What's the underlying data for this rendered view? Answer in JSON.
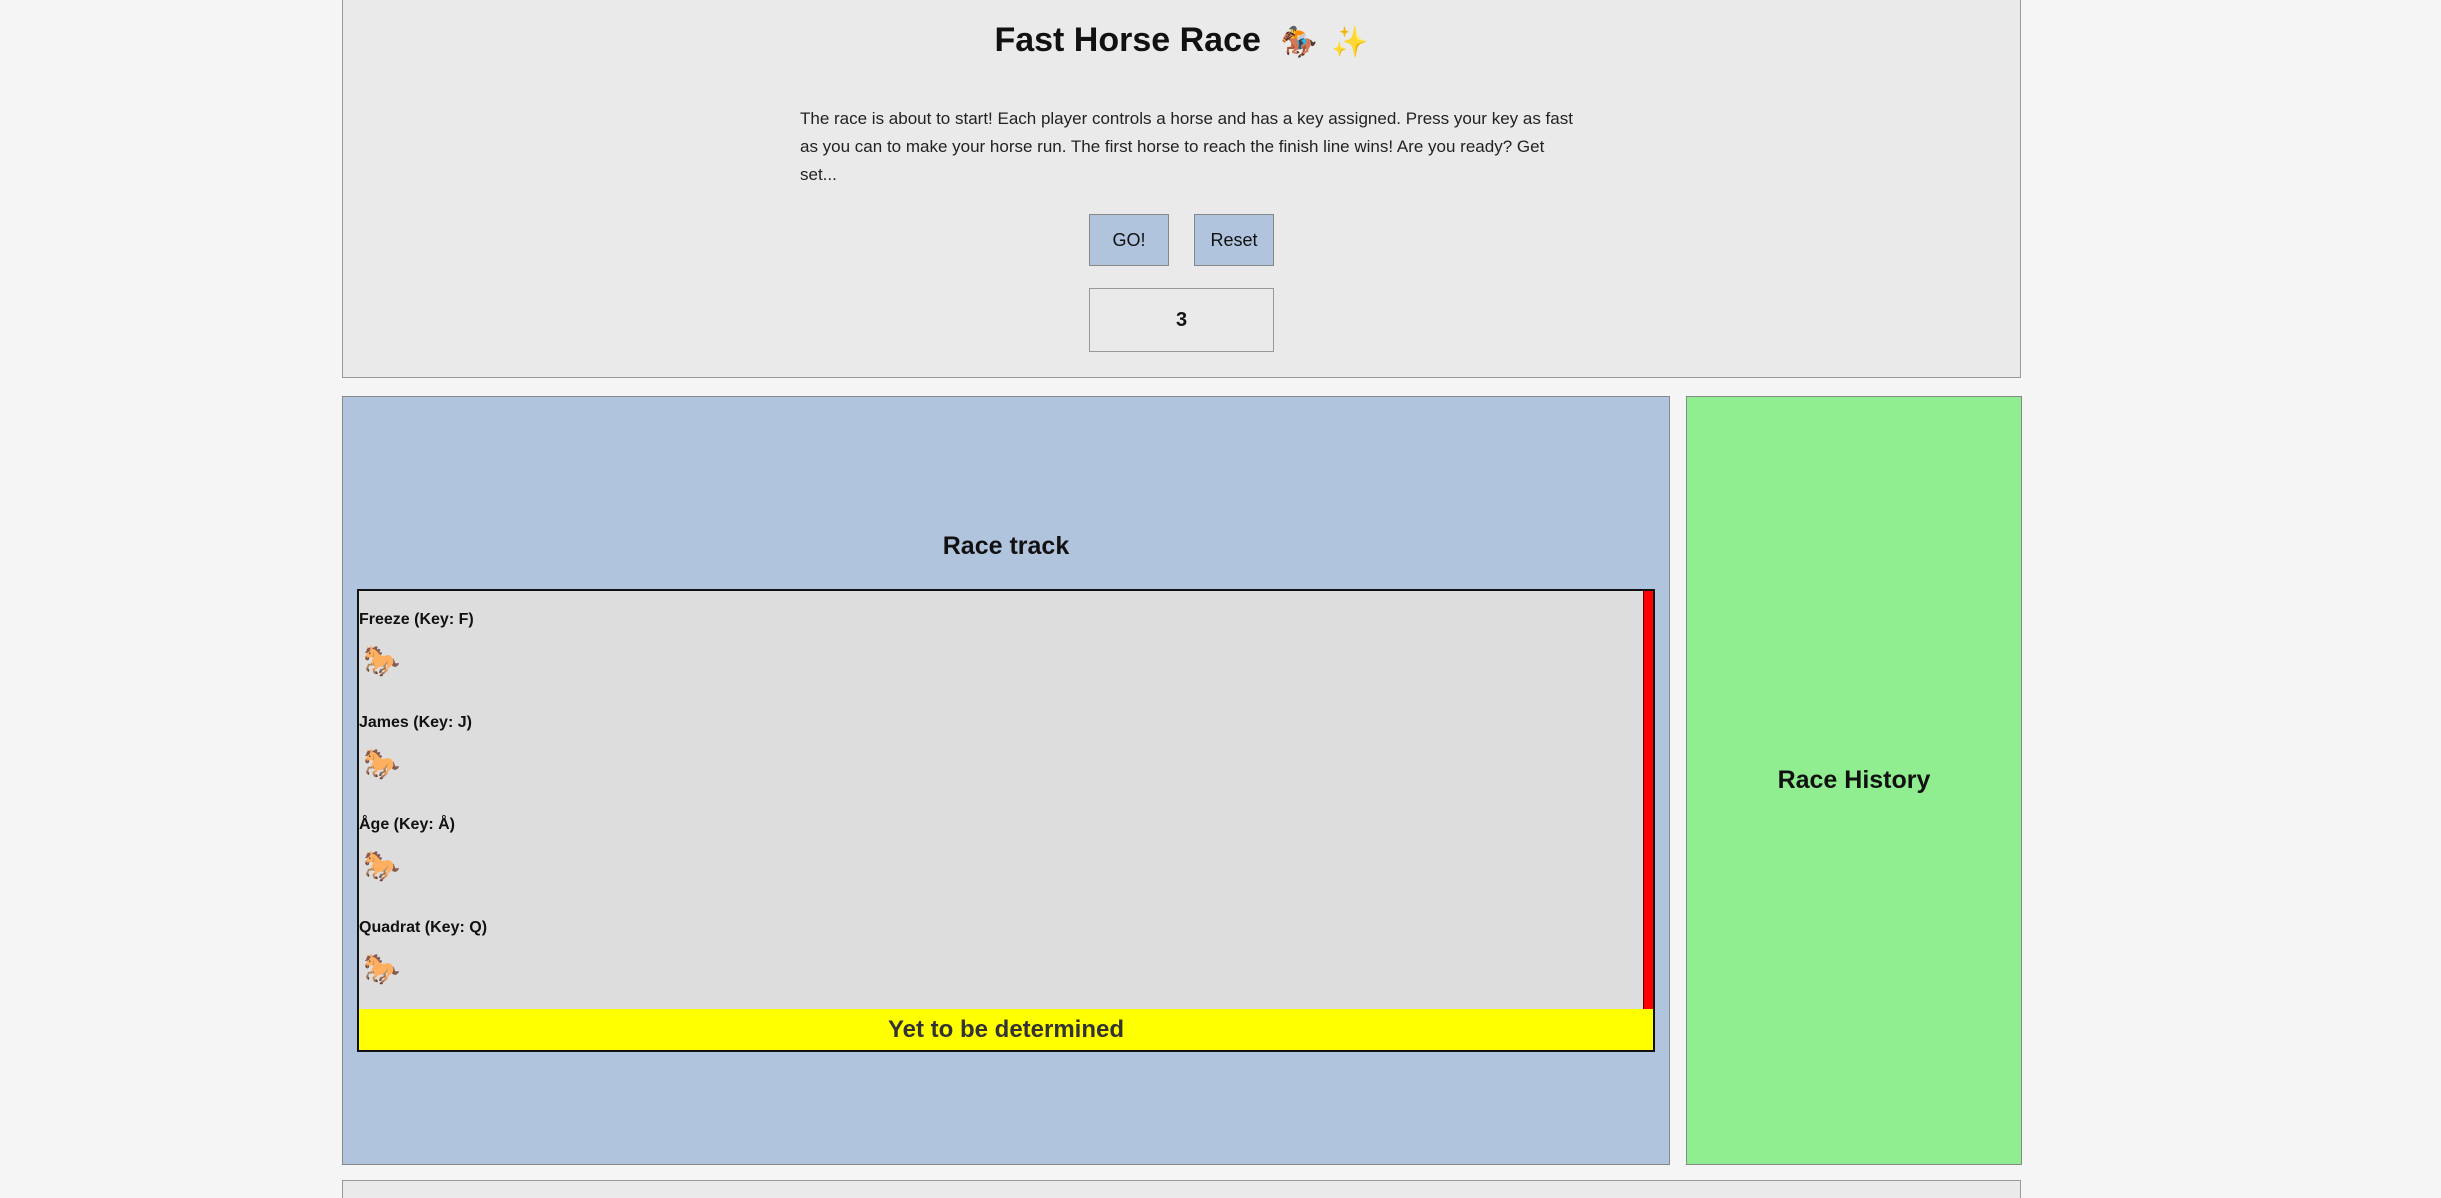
{
  "header": {
    "title": "Fast Horse Race",
    "title_icons": [
      "🏇",
      "✨"
    ],
    "intro": "The race is about to start! Each player controls a horse and has a key assigned. Press your key as fast as you can to make your horse run. The first horse to reach the finish line wins! Are you ready? Get set...",
    "go_label": "GO!",
    "reset_label": "Reset",
    "countdown": "3"
  },
  "track": {
    "title": "Race track",
    "lanes": [
      {
        "label": "Freeze (Key: F)",
        "horse": "🐎"
      },
      {
        "label": "James (Key: J)",
        "horse": "🐎"
      },
      {
        "label": "Åge (Key: Å)",
        "horse": "🐎"
      },
      {
        "label": "Quadrat (Key: Q)",
        "horse": "🐎"
      }
    ],
    "result": "Yet to be determined"
  },
  "history": {
    "title": "Race History"
  },
  "colors": {
    "track_panel": "#b0c4de",
    "history_panel": "#90ee90",
    "finish_line": "#ff0000",
    "result_bar": "#ffff00"
  }
}
